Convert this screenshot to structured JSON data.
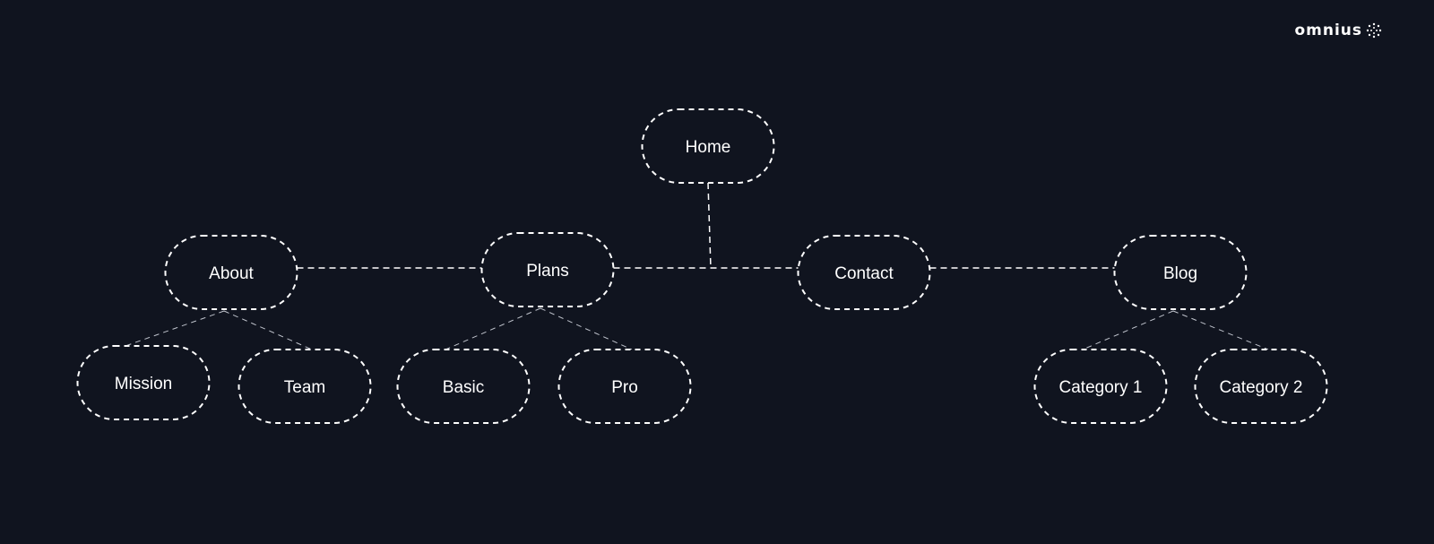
{
  "logo": {
    "text": "omnius"
  },
  "colors": {
    "background": "#10141f",
    "stroke": "#ffffff",
    "link": "#bfc3cc"
  },
  "nodes": [
    {
      "id": "home",
      "label": "Home"
    },
    {
      "id": "about",
      "label": "About"
    },
    {
      "id": "plans",
      "label": "Plans"
    },
    {
      "id": "contact",
      "label": "Contact"
    },
    {
      "id": "blog",
      "label": "Blog"
    },
    {
      "id": "mission",
      "label": "Mission"
    },
    {
      "id": "team",
      "label": "Team"
    },
    {
      "id": "basic",
      "label": "Basic"
    },
    {
      "id": "pro",
      "label": "Pro"
    },
    {
      "id": "category1",
      "label": "Category 1"
    },
    {
      "id": "category2",
      "label": "Category 2"
    }
  ],
  "edges": [
    [
      "home",
      "plans-contact-bus"
    ],
    [
      "about",
      "plans"
    ],
    [
      "plans",
      "contact"
    ],
    [
      "contact",
      "blog"
    ],
    [
      "about",
      "mission"
    ],
    [
      "about",
      "team"
    ],
    [
      "plans",
      "basic"
    ],
    [
      "plans",
      "pro"
    ],
    [
      "blog",
      "category1"
    ],
    [
      "blog",
      "category2"
    ]
  ]
}
